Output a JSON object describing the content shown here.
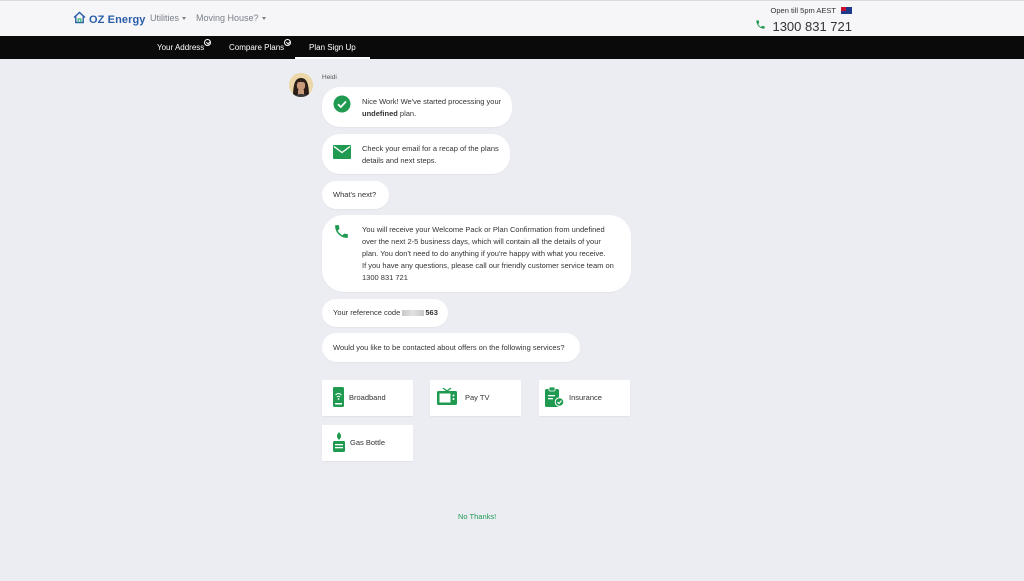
{
  "header": {
    "brand": "OZ Energy",
    "nav": [
      {
        "label": "Utilities"
      },
      {
        "label": "Moving House?"
      }
    ],
    "open_hours": "Open till 5pm AEST",
    "phone": "1300 831 721"
  },
  "tabs": [
    {
      "label": "Your Address",
      "completed": true
    },
    {
      "label": "Compare Plans",
      "completed": true
    },
    {
      "label": "Plan Sign Up",
      "active": true
    }
  ],
  "chat": {
    "agent_name": "Heidi",
    "msg_processing": {
      "line1": "Nice Work! We've started processing your",
      "plan_name": "undefined",
      "suffix": " plan."
    },
    "msg_email": {
      "line1": "Check your email for a recap of the plans",
      "line2": "details and next steps."
    },
    "msg_whats_next": "What's next?",
    "msg_welcome": {
      "line1": "You will receive your Welcome Pack or Plan Confirmation from undefined",
      "line2": "over the next 2-5 business days, which will contain all the details of your",
      "line3": "plan. You don't need to do anything if you're happy with what you receive.",
      "line4": "If you have any questions, please call our friendly customer service team on",
      "line5": "1300 831 721"
    },
    "msg_reference": {
      "label": "Your reference code ",
      "code_suffix": "563"
    },
    "msg_offers": "Would you like to be contacted about offers on the following services?"
  },
  "services": [
    {
      "label": "Broadband",
      "icon": "router-icon"
    },
    {
      "label": "Pay TV",
      "icon": "tv-icon"
    },
    {
      "label": "Insurance",
      "icon": "clipboard-check-icon"
    },
    {
      "label": "Gas Bottle",
      "icon": "gas-bottle-icon"
    }
  ],
  "no_thanks": "No Thanks!",
  "colors": {
    "accent_green": "#1f9a50",
    "brand_blue": "#2a5da8",
    "tab_bar": "#0a0a0a",
    "page_bg": "#ecedf3"
  }
}
